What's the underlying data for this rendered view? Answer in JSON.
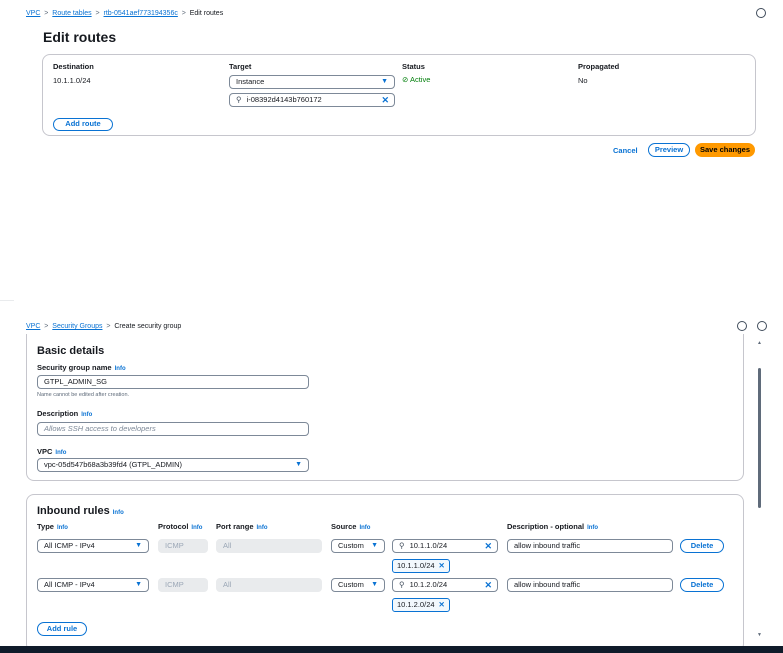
{
  "top": {
    "breadcrumbs": [
      "VPC",
      "Route tables",
      "rtb-0541aef773194356c",
      "Edit routes"
    ],
    "title": "Edit routes",
    "columns": [
      "Destination",
      "Target",
      "Status",
      "Propagated"
    ],
    "route": {
      "destination": "10.1.1.0/24",
      "target_type": "Instance",
      "target_value": "i-08392d4143b760172",
      "status": "Active",
      "propagated": "No"
    },
    "add_route": "Add route",
    "cancel": "Cancel",
    "preview": "Preview",
    "save": "Save changes"
  },
  "bottom": {
    "breadcrumbs": [
      "VPC",
      "Security Groups",
      "Create security group"
    ],
    "basic_title": "Basic details",
    "sg_name_label": "Security group name",
    "info": "Info",
    "sg_name_value": "GTPL_ADMIN_SG",
    "sg_name_hint": "Name cannot be edited after creation.",
    "desc_label": "Description",
    "desc_placeholder": "Allows SSH access to developers",
    "vpc_label": "VPC",
    "vpc_value": "vpc-05d547b68a3b39fd4 (GTPL_ADMIN)",
    "inbound_title": "Inbound rules",
    "col_type": "Type",
    "col_protocol": "Protocol",
    "col_port": "Port range",
    "col_source": "Source",
    "col_desc": "Description - optional",
    "rules": [
      {
        "type": "All ICMP - IPv4",
        "protocol": "ICMP",
        "port": "All",
        "source": "Custom",
        "cidr": "10.1.1.0/24",
        "token": "10.1.1.0/24",
        "desc": "allow inbound traffic",
        "delete": "Delete"
      },
      {
        "type": "All ICMP - IPv4",
        "protocol": "ICMP",
        "port": "All",
        "source": "Custom",
        "cidr": "10.1.2.0/24",
        "token": "10.1.2.0/24",
        "desc": "allow inbound traffic",
        "delete": "Delete"
      }
    ],
    "add_rule": "Add rule"
  }
}
